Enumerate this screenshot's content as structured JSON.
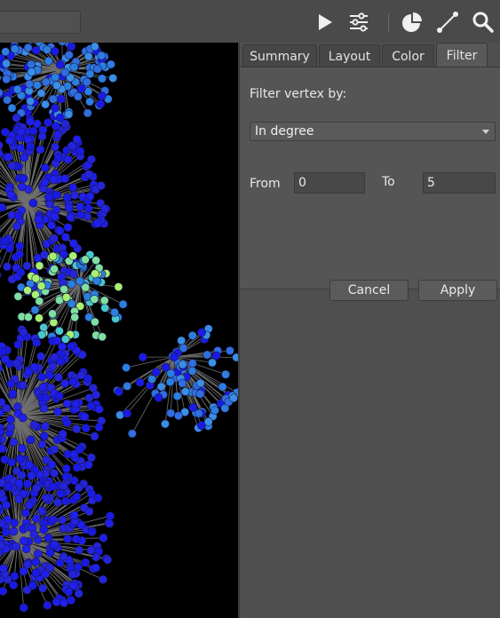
{
  "toolbar": {
    "icons": [
      "play-icon",
      "sliders-icon",
      "pie-chart-icon",
      "edge-icon",
      "search-icon"
    ]
  },
  "tabs": [
    {
      "label": "Summary"
    },
    {
      "label": "Layout"
    },
    {
      "label": "Color"
    },
    {
      "label": "Filter",
      "active": true
    }
  ],
  "filter": {
    "heading": "Filter vertex by:",
    "selected": "In degree",
    "from_label": "From",
    "from_value": "0",
    "to_label": "To",
    "to_value": "5",
    "cancel_label": "Cancel",
    "apply_label": "Apply"
  },
  "colors": {
    "graph_background": "#000000",
    "edge": "#6f6f6f",
    "node_low": "#1a1ae6",
    "node_mid": "#2b7fe0",
    "node_high": "#a8f070"
  }
}
